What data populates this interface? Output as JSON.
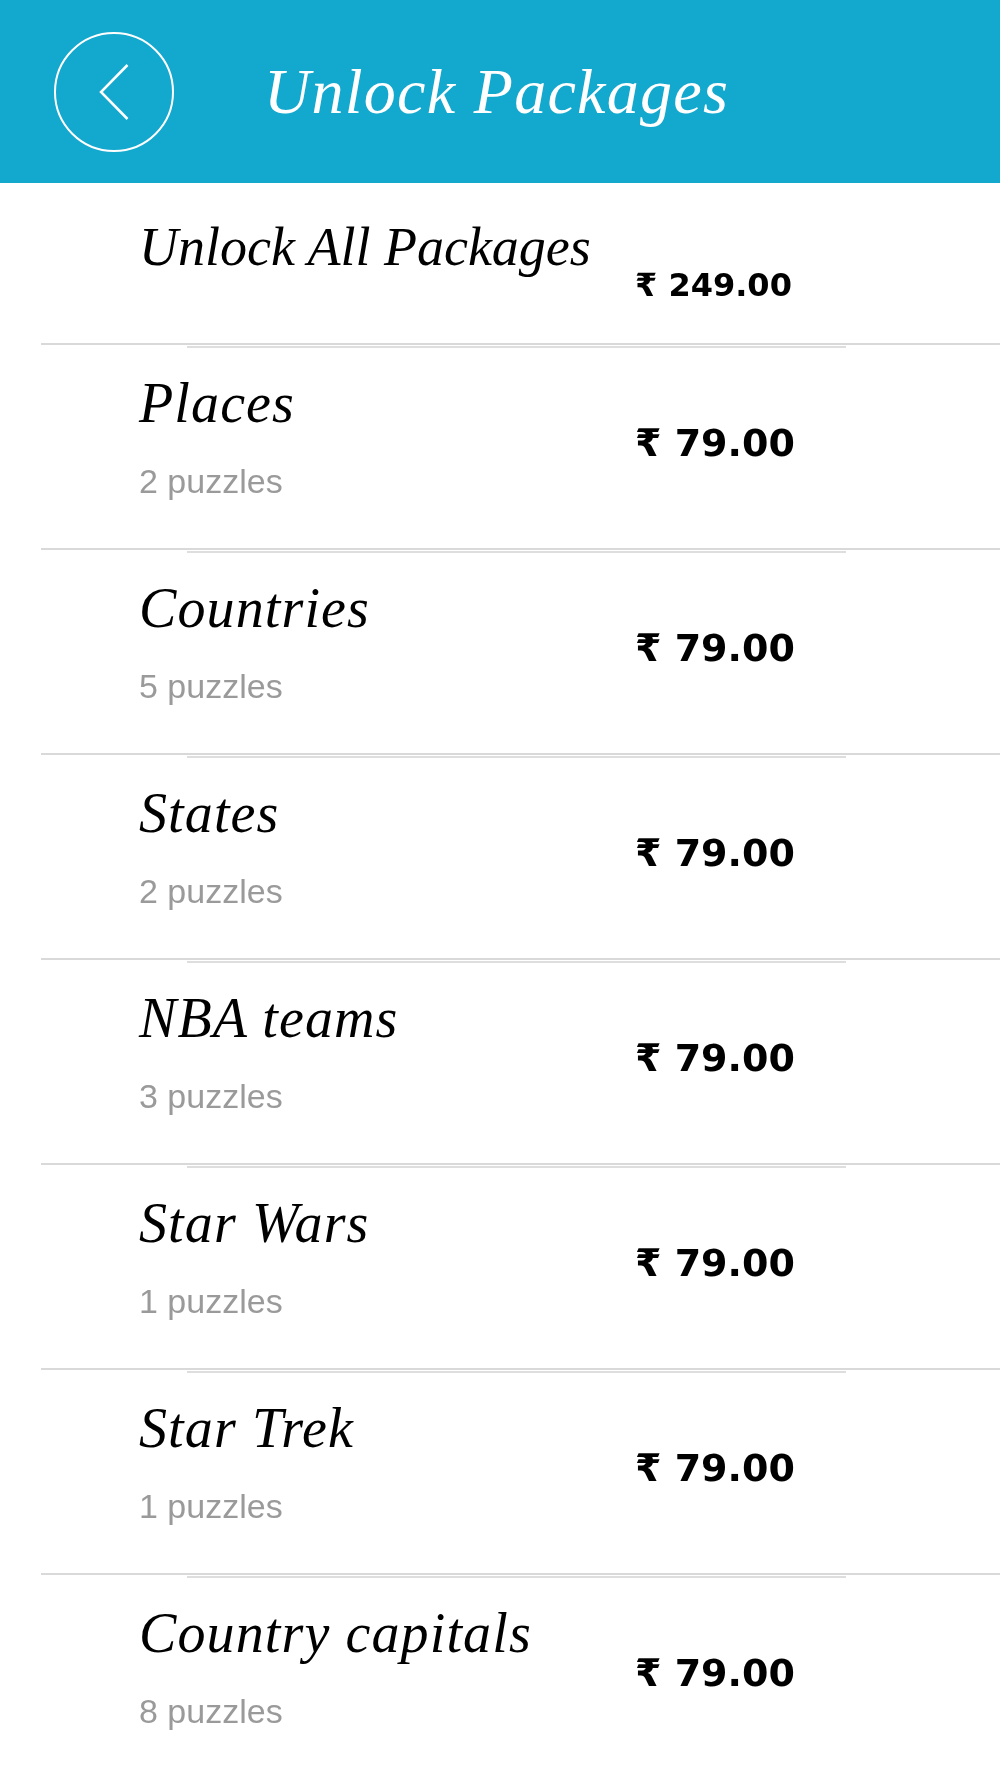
{
  "header": {
    "title": "Unlock Packages"
  },
  "packages": [
    {
      "kind": "bundle",
      "name": "Unlock All Packages",
      "price": "₹ 249.00"
    },
    {
      "kind": "package",
      "name": "Places",
      "count": "2 puzzles",
      "price": "₹ 79.00"
    },
    {
      "kind": "package",
      "name": "Countries",
      "count": "5 puzzles",
      "price": "₹ 79.00"
    },
    {
      "kind": "package",
      "name": "States",
      "count": "2 puzzles",
      "price": "₹ 79.00"
    },
    {
      "kind": "package",
      "name": "NBA teams",
      "count": "3 puzzles",
      "price": "₹ 79.00"
    },
    {
      "kind": "package",
      "name": "Star Wars",
      "count": "1 puzzles",
      "price": "₹ 79.00"
    },
    {
      "kind": "package",
      "name": "Star Trek",
      "count": "1 puzzles",
      "price": "₹ 79.00"
    },
    {
      "kind": "package",
      "name": "Country capitals",
      "count": "8 puzzles",
      "price": "₹ 79.00"
    }
  ]
}
